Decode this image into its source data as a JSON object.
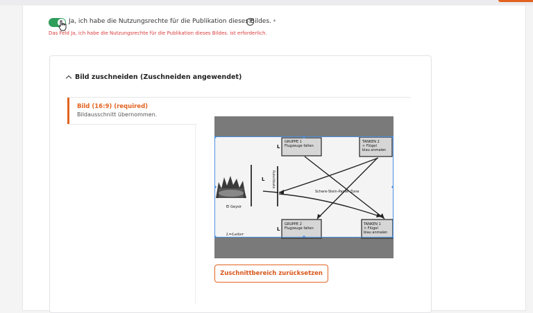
{
  "consent": {
    "label": "Ja, ich habe die Nutzungsrechte für die Publikation dieses Bildes.",
    "required_mark": "*",
    "help_glyph": "?",
    "error": "Das Feld Ja, ich habe die Nutzungsrechte für die Publikation dieses Bildes. ist erforderlich.",
    "toggle_state": "on"
  },
  "crop_panel": {
    "title": "Bild zuschneiden (Zuschneiden angewendet)",
    "tab": {
      "title": "Bild (16:9) (required)",
      "subtitle": "Bildausschnitt übernommen."
    },
    "reset_button": "Zuschnittbereich zurücksetzen"
  },
  "image": {
    "gruppe1_title": "GRUPPE 1",
    "gruppe1_sub": "Flugzeuge falten",
    "tanken2_title": "TANKEN 2",
    "tanken2_line1": "> Flügel",
    "tanken2_line2": "blau anmalen",
    "gruppe2_title": "GRUPPE 2",
    "gruppe2_sub": "Flugzeuge falten",
    "tanken1_title": "TANKEN 1",
    "tanken1_line1": "> Flügel",
    "tanken1_line2": "blau anmalen",
    "l_marker": "L",
    "zone": "Schere-Stein-Papier Zone",
    "geysir": "El Geysir",
    "rutschbahn": "Rutschbahn",
    "legend": "L=Leiter"
  },
  "colors": {
    "accent": "#e2631f",
    "toggle_on": "#2f9e5b",
    "error": "#d93a3a",
    "crop_selection": "#4a8fe0",
    "crop_mask": "#7a7a7a"
  }
}
